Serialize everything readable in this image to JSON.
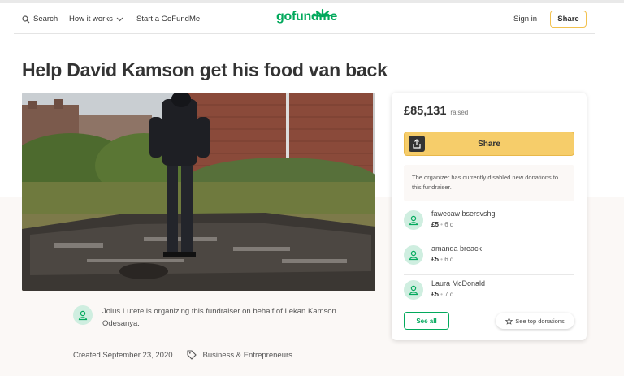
{
  "header": {
    "search_label": "Search",
    "how_it_works_label": "How it works",
    "start_label": "Start a GoFundMe",
    "logo_text": "gofundme",
    "signin_label": "Sign in",
    "share_label": "Share"
  },
  "campaign": {
    "title": "Help David Kamson get his food van back",
    "organizer_text": "Jolus Lutete is organizing this fundraiser on behalf of Lekan Kamson Odesanya.",
    "created": "Created September 23, 2020",
    "category": "Business & Entrepreneurs"
  },
  "card": {
    "amount": "£85,131",
    "raised_label": "raised",
    "share_label": "Share",
    "notice": "The organizer has currently disabled new donations to this fundraiser.",
    "donations": [
      {
        "name": "fawecaw bsersvshg",
        "amount": "£5",
        "time": "6 d"
      },
      {
        "name": "amanda breack",
        "amount": "£5",
        "time": "6 d"
      },
      {
        "name": "Laura McDonald",
        "amount": "£5",
        "time": "7 d"
      }
    ],
    "see_all_label": "See all",
    "see_top_label": "See top donations"
  },
  "colors": {
    "brand_green": "#02a95c",
    "share_yellow": "#f6cd6a",
    "avatar_bg": "#cfeee0"
  }
}
